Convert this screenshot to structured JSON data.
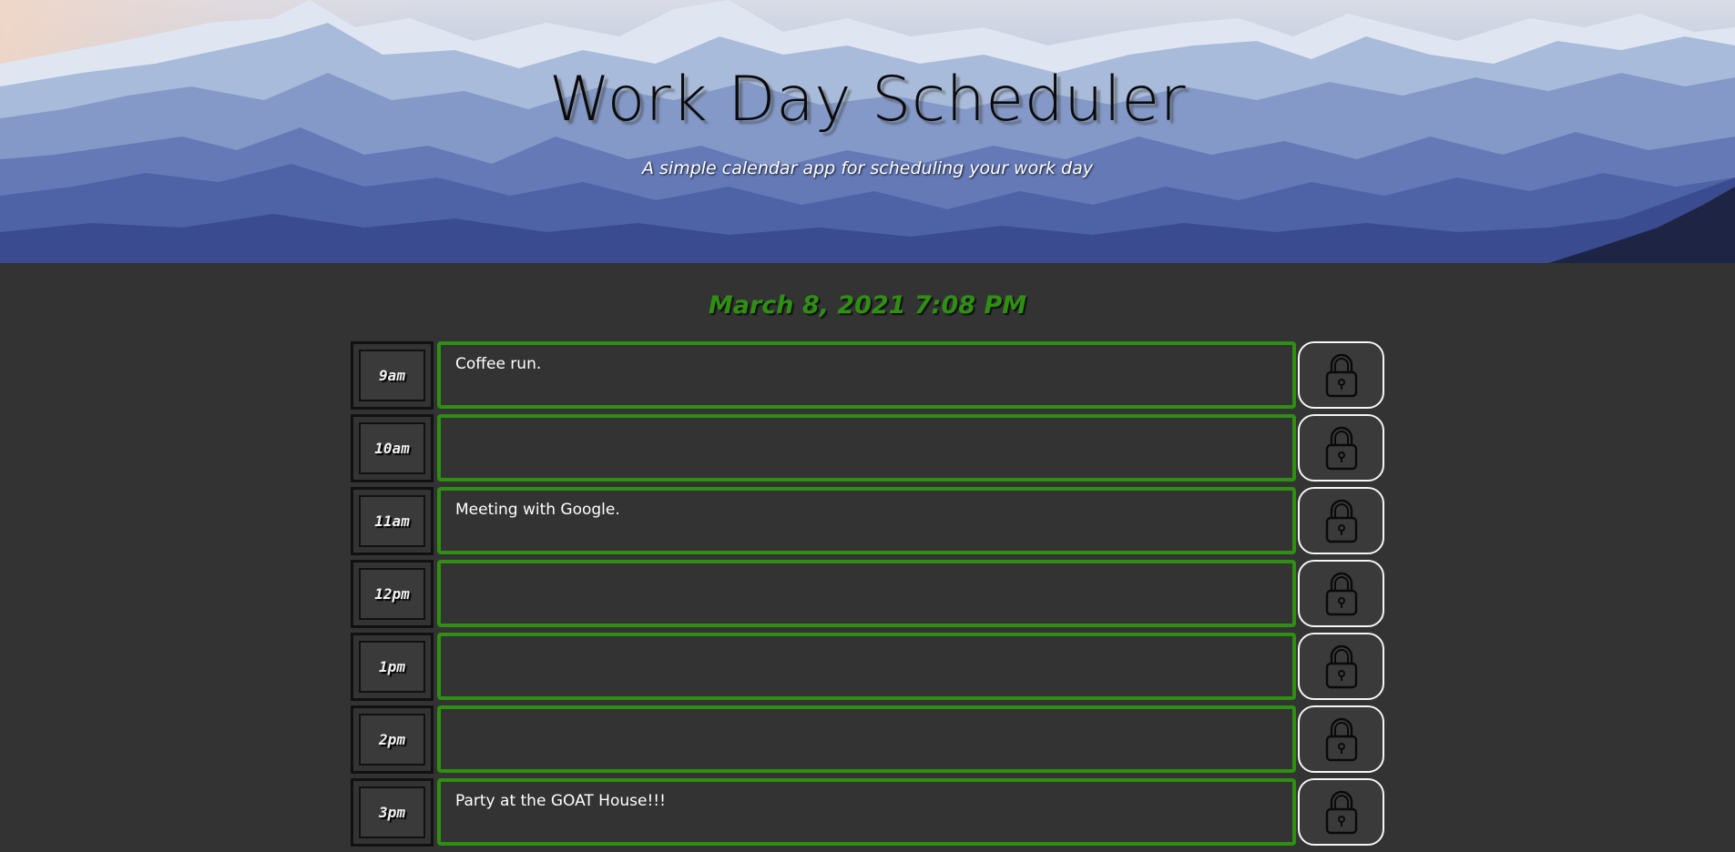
{
  "header": {
    "title": "Work Day Scheduler",
    "subtitle": "A simple calendar app for scheduling your work day"
  },
  "current_datetime": "March 8, 2021 7:08 PM",
  "colors": {
    "background": "#333333",
    "present_border": "#2e8f12",
    "datetime_text": "#2f8f14"
  },
  "save_icon": "lock-icon",
  "time_blocks": [
    {
      "hour": "9am",
      "text": "Coffee run."
    },
    {
      "hour": "10am",
      "text": ""
    },
    {
      "hour": "11am",
      "text": "Meeting with Google."
    },
    {
      "hour": "12pm",
      "text": ""
    },
    {
      "hour": "1pm",
      "text": ""
    },
    {
      "hour": "2pm",
      "text": ""
    },
    {
      "hour": "3pm",
      "text": "Party at the GOAT House!!!"
    }
  ]
}
